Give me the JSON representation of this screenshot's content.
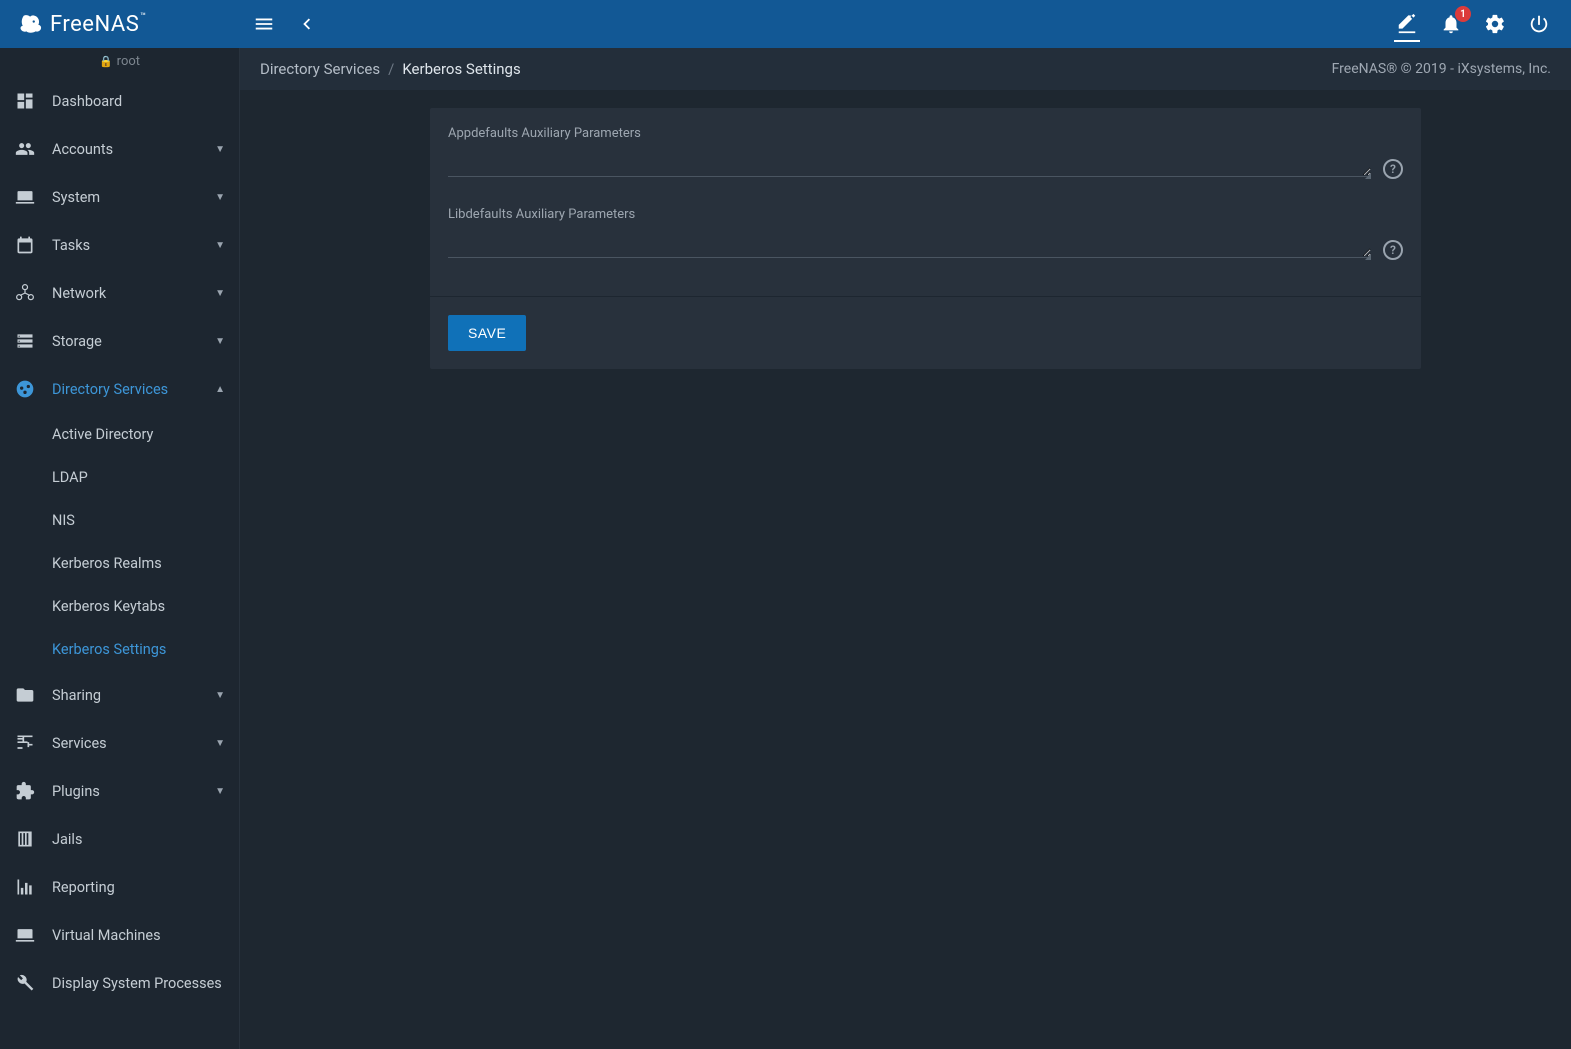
{
  "brand": "FreeNAS",
  "user": {
    "name": "root"
  },
  "notification_count": "1",
  "breadcrumb": {
    "parent": "Directory Services",
    "current": "Kerberos Settings"
  },
  "copyright": "FreeNAS® © 2019 - iXsystems, Inc.",
  "sidebar": {
    "items": [
      {
        "label": "Dashboard",
        "icon": "dashboard",
        "expandable": false
      },
      {
        "label": "Accounts",
        "icon": "accounts",
        "expandable": true
      },
      {
        "label": "System",
        "icon": "laptop",
        "expandable": true
      },
      {
        "label": "Tasks",
        "icon": "calendar",
        "expandable": true
      },
      {
        "label": "Network",
        "icon": "network",
        "expandable": true
      },
      {
        "label": "Storage",
        "icon": "storage",
        "expandable": true
      },
      {
        "label": "Directory Services",
        "icon": "dirserv",
        "expandable": true,
        "active": true,
        "expanded": true,
        "children": [
          {
            "label": "Active Directory"
          },
          {
            "label": "LDAP"
          },
          {
            "label": "NIS"
          },
          {
            "label": "Kerberos Realms"
          },
          {
            "label": "Kerberos Keytabs"
          },
          {
            "label": "Kerberos Settings",
            "active": true
          }
        ]
      },
      {
        "label": "Sharing",
        "icon": "folder",
        "expandable": true
      },
      {
        "label": "Services",
        "icon": "tune",
        "expandable": true
      },
      {
        "label": "Plugins",
        "icon": "puzzle",
        "expandable": true
      },
      {
        "label": "Jails",
        "icon": "jail",
        "expandable": false
      },
      {
        "label": "Reporting",
        "icon": "chart",
        "expandable": false
      },
      {
        "label": "Virtual Machines",
        "icon": "laptop",
        "expandable": false
      },
      {
        "label": "Display System Processes",
        "icon": "wrench",
        "expandable": false
      }
    ]
  },
  "form": {
    "fields": [
      {
        "label": "Appdefaults Auxiliary Parameters",
        "value": ""
      },
      {
        "label": "Libdefaults Auxiliary Parameters",
        "value": ""
      }
    ],
    "save_label": "SAVE"
  }
}
